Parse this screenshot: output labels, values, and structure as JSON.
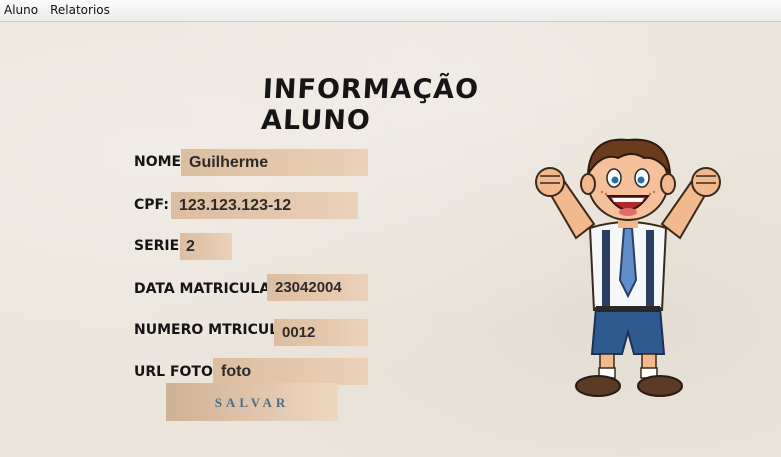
{
  "menu": {
    "items": [
      "Aluno",
      "Relatorios"
    ]
  },
  "form": {
    "title": "INFORMAÇÃO ALUNO",
    "nome": {
      "label": "NOME:",
      "value": "Guilherme"
    },
    "cpf": {
      "label": "CPF:",
      "value": "123.123.123-12"
    },
    "serie": {
      "label": "SERIE:",
      "value": "2"
    },
    "data_matricula": {
      "label": "DATA MATRICULA:",
      "value": "23042004"
    },
    "numero_matricula": {
      "label": "NUMERO MTRICULA:",
      "value": "0012"
    },
    "url_foto": {
      "label": "URL FOTO:",
      "value": "foto"
    },
    "save_label": "SALVAR"
  },
  "illustration": {
    "icon": "cartoon-student-boy-icon"
  }
}
